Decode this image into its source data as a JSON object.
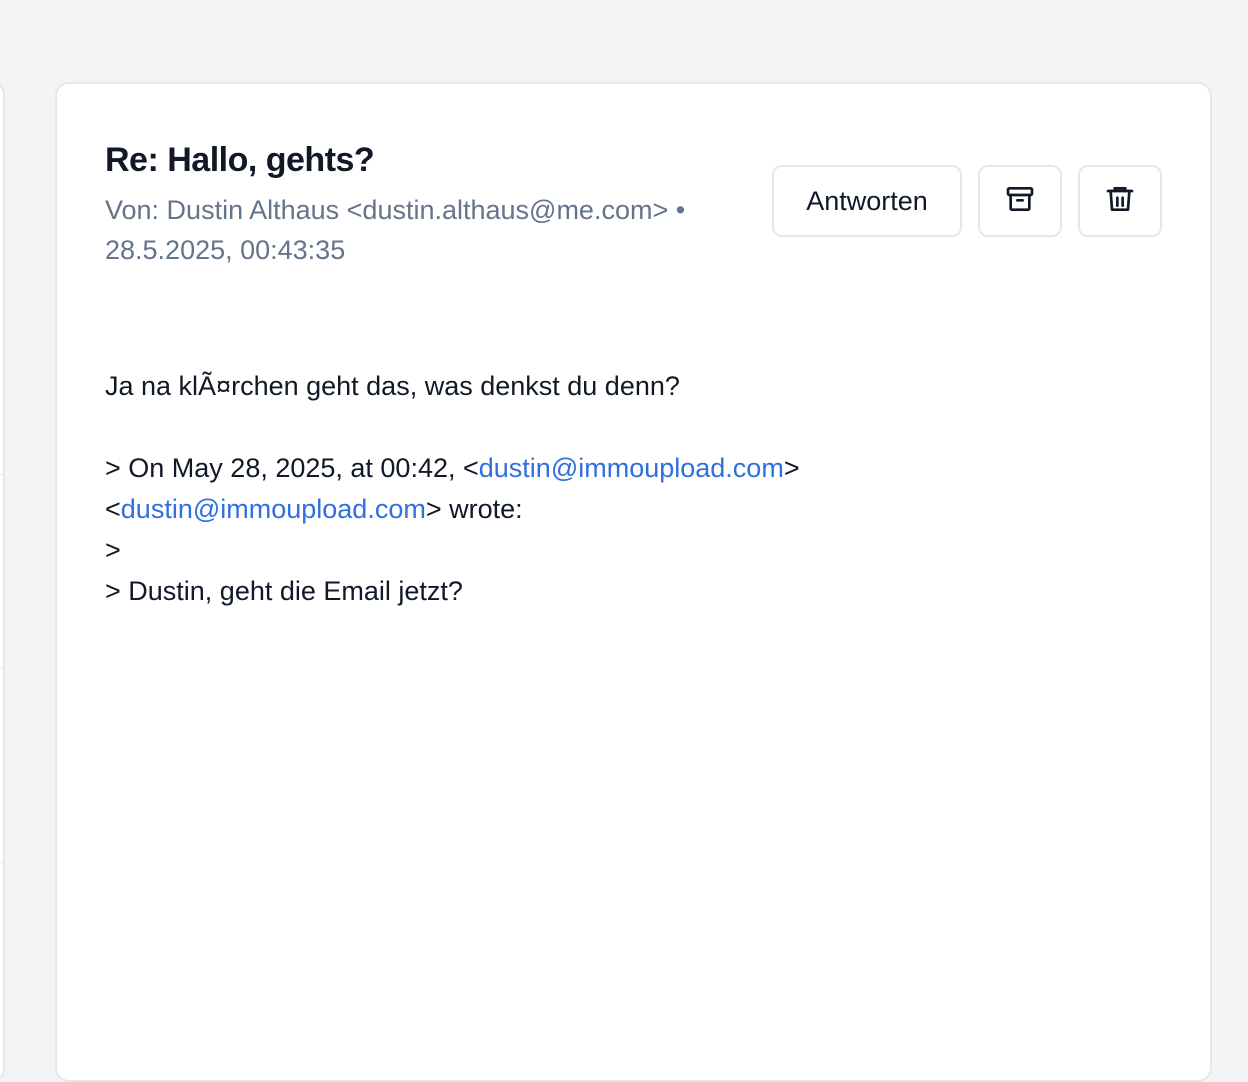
{
  "email": {
    "subject": "Re: Hallo, gehts?",
    "from_label": "Von: Dustin Althaus <dustin.althaus@me.com> •",
    "timestamp": "28.5.2025, 00:43:35"
  },
  "actions": {
    "reply_label": "Antworten",
    "archive_icon": "archive-icon",
    "delete_icon": "trash-icon"
  },
  "body": {
    "line1": "Ja na klÃ¤rchen geht das, was denkst du denn?",
    "quote_prefix": "> On May 28, 2025, at 00:42, <",
    "quote_link1": "dustin@immoupload.com",
    "quote_suffix1": ">",
    "quote_open2": "<",
    "quote_link2": "dustin@immoupload.com",
    "quote_suffix2": "> wrote:",
    "quote_blank": ">",
    "quote_text": "> Dustin, geht die Email jetzt?"
  },
  "colors": {
    "background": "#f3f4f6",
    "card": "#ffffff",
    "border": "#e5e7eb",
    "meta_text": "#64748b",
    "link": "#2f6fde"
  }
}
